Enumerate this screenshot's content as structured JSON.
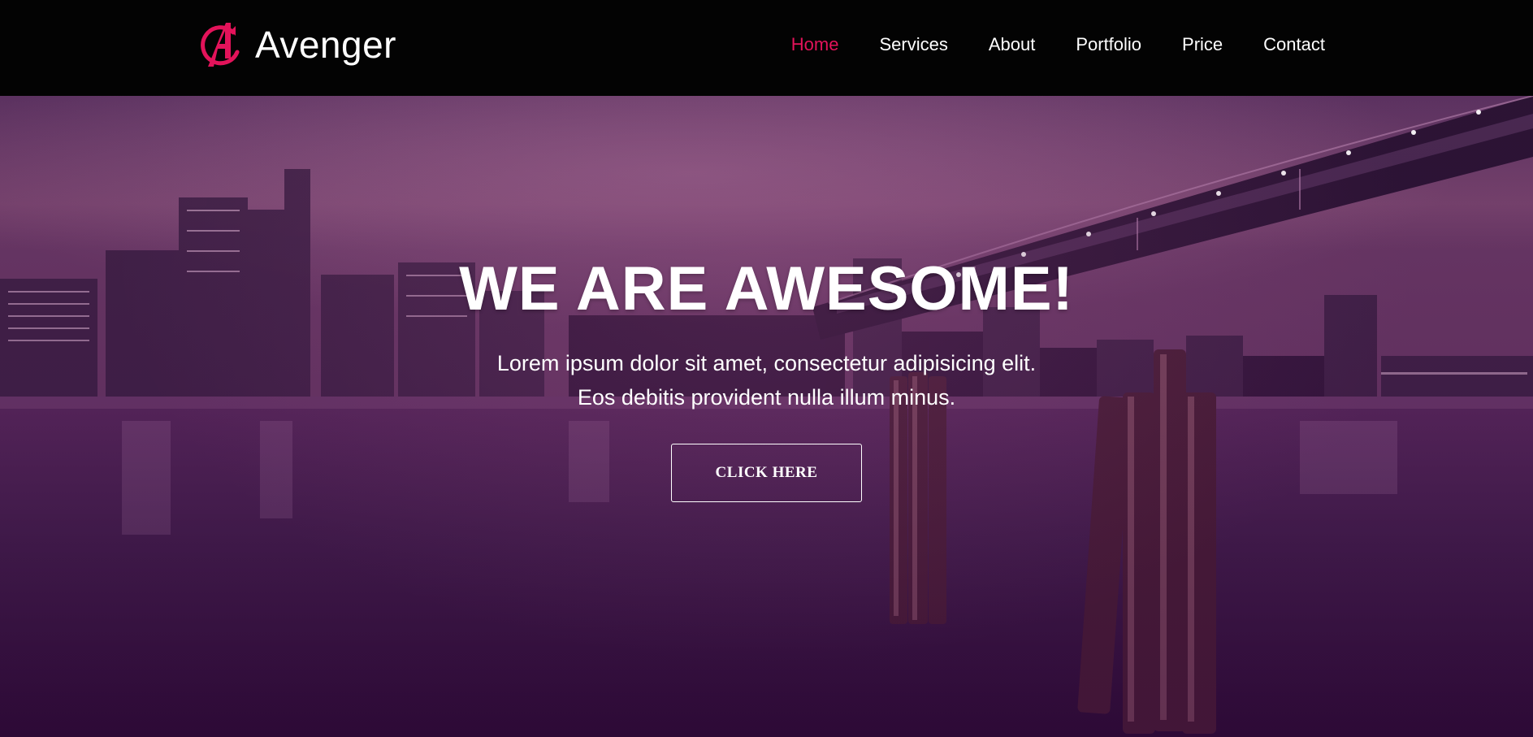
{
  "brand": {
    "name": "Avenger",
    "logo_icon": "avengers-a-logo-icon",
    "accent_color": "#e3135a"
  },
  "nav": {
    "items": [
      {
        "label": "Home",
        "active": true
      },
      {
        "label": "Services",
        "active": false
      },
      {
        "label": "About",
        "active": false
      },
      {
        "label": "Portfolio",
        "active": false
      },
      {
        "label": "Price",
        "active": false
      },
      {
        "label": "Contact",
        "active": false
      }
    ]
  },
  "hero": {
    "title": "WE ARE AWESOME!",
    "subtitle_line1": "Lorem ipsum dolor sit amet, consectetur adipisicing elit.",
    "subtitle_line2": "Eos debitis provident nulla illum minus.",
    "cta_label": "CLICK HERE",
    "background": "night-city-bridge-river-image",
    "overlay_color": "#5a1f5c"
  }
}
